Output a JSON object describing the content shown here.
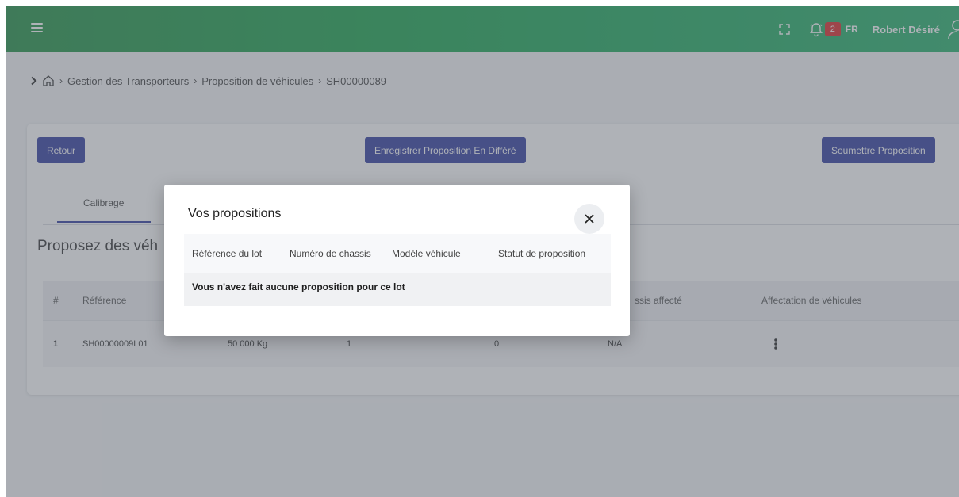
{
  "header": {
    "notification_count": "2",
    "language": "FR",
    "user_name": "Robert Désiré"
  },
  "breadcrumb": {
    "items": [
      "Gestion des Transporteurs",
      "Proposition de véhicules",
      "SH00000089"
    ]
  },
  "toolbar": {
    "back_label": "Retour",
    "save_deferred_label": "Enregistrer Proposition En Différé",
    "submit_label": "Soumettre Proposition"
  },
  "tabs": [
    {
      "label": "Calibrage",
      "active": true
    }
  ],
  "main": {
    "section_title": "Proposez des véh",
    "table": {
      "headers": [
        "#",
        "Référence",
        "ssis affecté",
        "Affectation de véhicules"
      ],
      "rows": [
        {
          "index": "1",
          "reference": "SH00000009L01",
          "weight": "50 000 Kg",
          "count": "1",
          "assigned": "0",
          "chassis": "N/A"
        }
      ]
    }
  },
  "modal": {
    "title": "Vos propositions",
    "headers": [
      "Référence du lot",
      "Numéro de chassis",
      "Modèle véhicule",
      "Statut de proposition"
    ],
    "empty_message": "Vous n'avez fait aucune proposition pour ce lot"
  },
  "colors": {
    "header_green": "#1aa04d",
    "primary_button": "#2f3a9e",
    "badge_red": "#dc2626"
  },
  "icons": [
    "hamburger-icon",
    "fullscreen-icon",
    "bell-icon",
    "user-icon",
    "home-icon",
    "chevron-right-icon",
    "close-icon",
    "kebab-icon"
  ]
}
